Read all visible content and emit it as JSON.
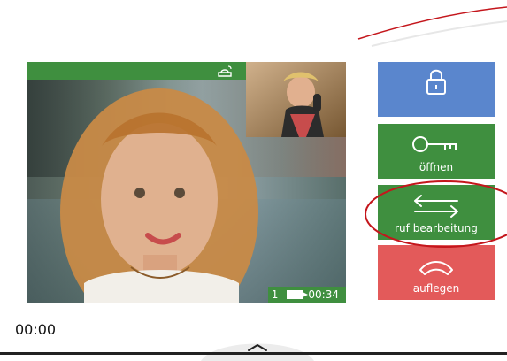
{
  "video": {
    "timer": "00:34",
    "camera_count": "1"
  },
  "buttons": {
    "unlock_label": "",
    "open_label": "öffnen",
    "transfer_label": "ruf bearbeitung",
    "hangup_label": "auflegen"
  },
  "footer": {
    "elapsed": "00:00"
  },
  "colors": {
    "green": "#3f8f3f",
    "blue": "#5a86cd",
    "red": "#e35a5a",
    "highlight": "#c4161c"
  },
  "icons": {
    "top_status": "handset-icon",
    "unlock": "padlock-icon",
    "open": "key-icon",
    "transfer": "transfer-arrows-icon",
    "hangup": "phone-hangup-icon",
    "bottom_handle": "chevron-up-icon"
  }
}
